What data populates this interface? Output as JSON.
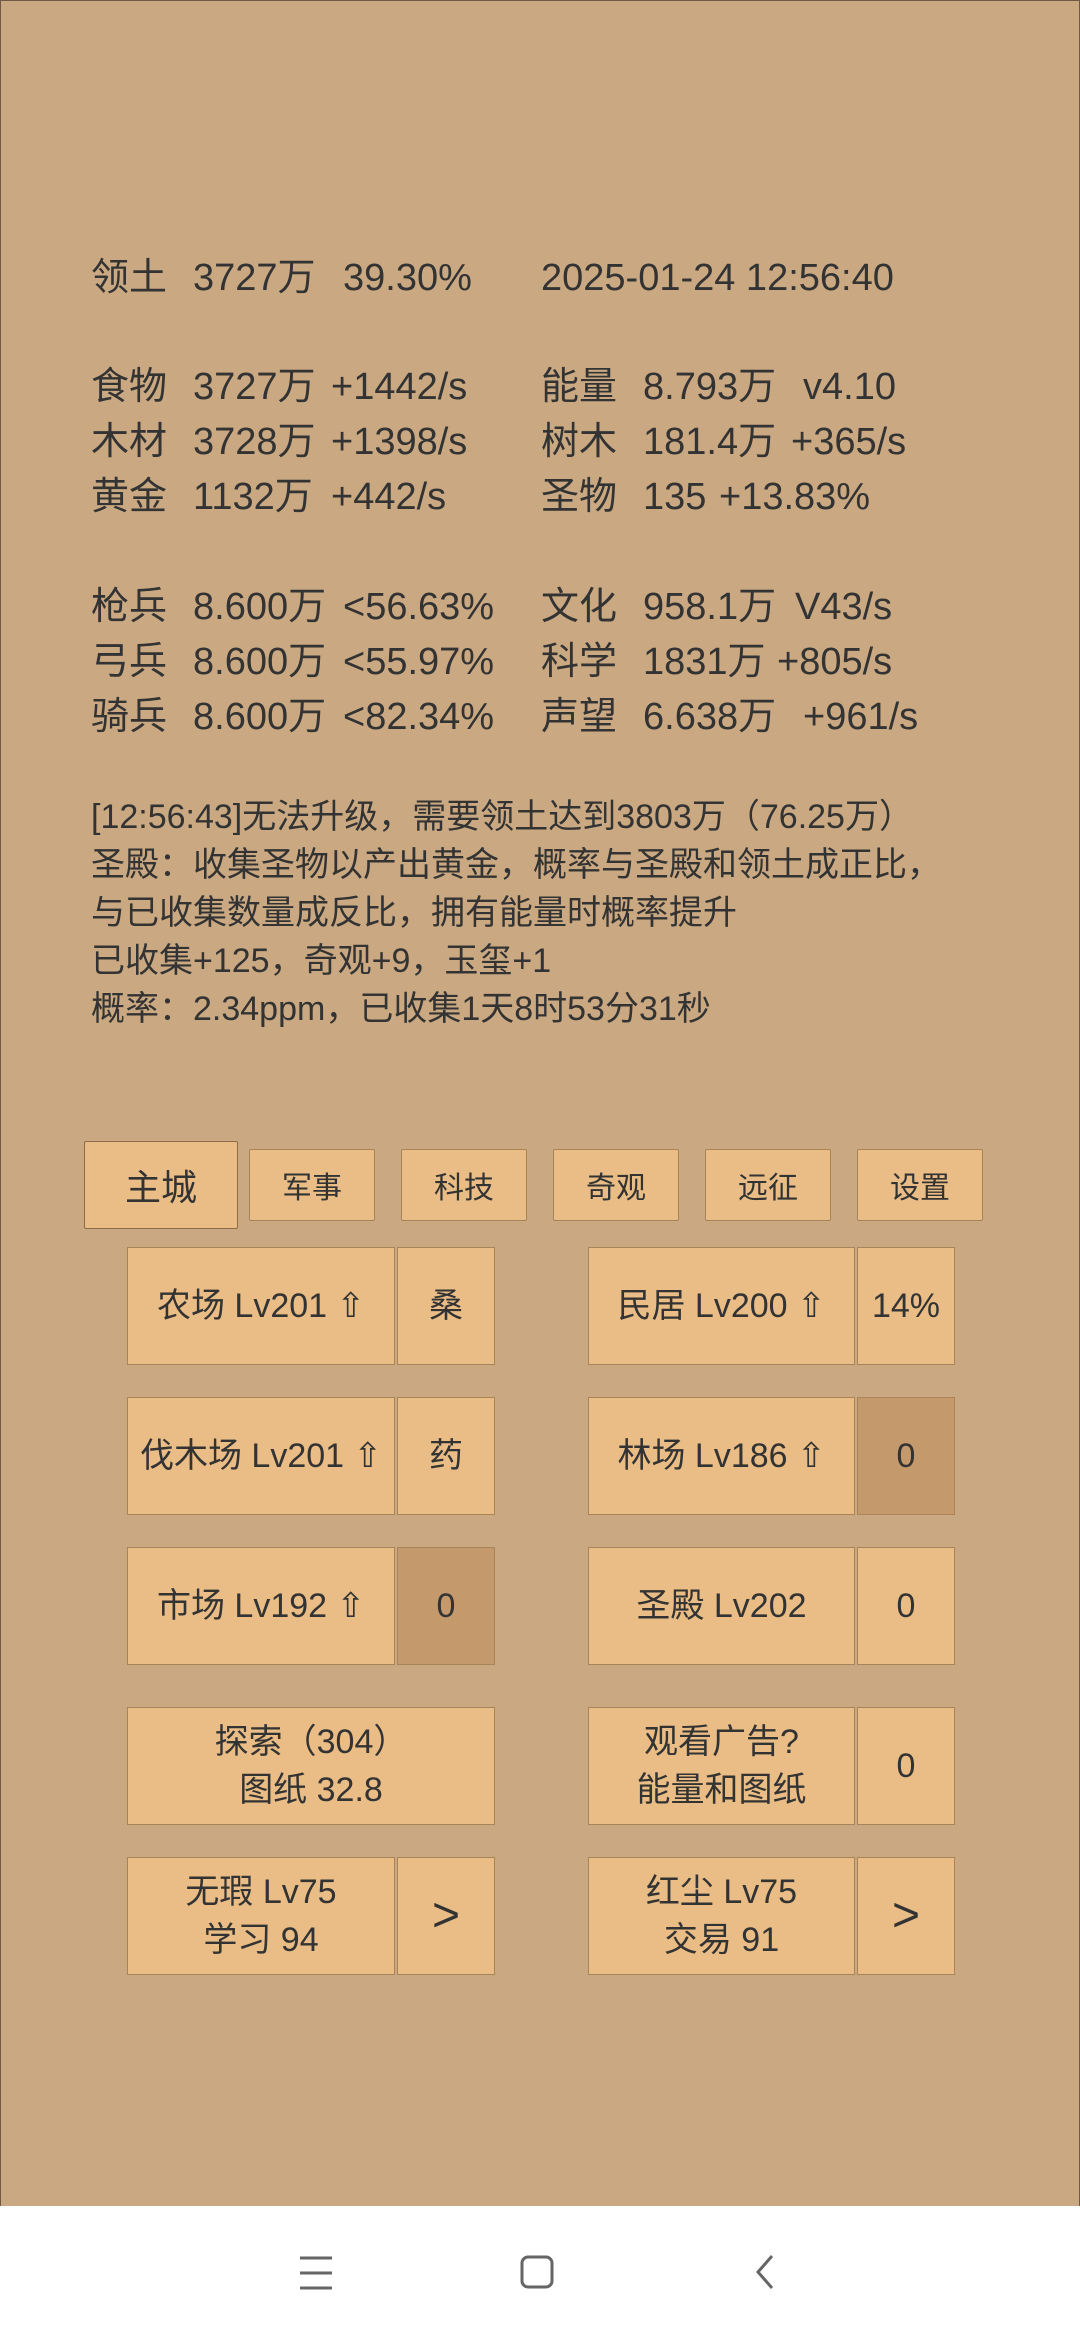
{
  "stats": {
    "territory": {
      "label": "领土",
      "value": "3727万",
      "pct": "39.30%"
    },
    "datetime": "2025-01-24 12:56:40",
    "resources_left": [
      {
        "label": "食物",
        "value": "3727万",
        "rate": "+1442/s"
      },
      {
        "label": "木材",
        "value": "3728万",
        "rate": "+1398/s"
      },
      {
        "label": "黄金",
        "value": "1132万",
        "rate": "+442/s"
      }
    ],
    "resources_right": [
      {
        "label": "能量",
        "value": "8.793万",
        "rate": "v4.10"
      },
      {
        "label": "树木",
        "value": "181.4万",
        "rate": "+365/s"
      },
      {
        "label": "圣物",
        "value": "135",
        "rate": "+13.83%"
      }
    ],
    "troops": [
      {
        "label": "枪兵",
        "value": "8.600万",
        "rate": "<56.63%"
      },
      {
        "label": "弓兵",
        "value": "8.600万",
        "rate": "<55.97%"
      },
      {
        "label": "骑兵",
        "value": "8.600万",
        "rate": "<82.34%"
      }
    ],
    "culture": [
      {
        "label": "文化",
        "value": "958.1万",
        "rate": "V43/s"
      },
      {
        "label": "科学",
        "value": "1831万",
        "rate": "+805/s"
      },
      {
        "label": "声望",
        "value": "6.638万",
        "rate": "+961/s"
      }
    ]
  },
  "messages": [
    "[12:56:43]无法升级，需要领土达到3803万（76.25万）",
    "圣殿：收集圣物以产出黄金，概率与圣殿和领土成正比，",
    "与已收集数量成反比，拥有能量时概率提升",
    "已收集+125，奇观+9，玉玺+1",
    "概率：2.34ppm，已收集1天8时53分31秒"
  ],
  "tabs": [
    "主城",
    "军事",
    "科技",
    "奇观",
    "远征",
    "设置"
  ],
  "buildings": {
    "farm": "农场 Lv201 ⇧",
    "farm_side": "桑",
    "house": "民居 Lv200 ⇧",
    "house_side": "14%",
    "lumber": "伐木场 Lv201 ⇧",
    "lumber_side": "药",
    "forest": "林场 Lv186 ⇧",
    "forest_side": "0",
    "market": "市场 Lv192 ⇧",
    "market_side": "0",
    "temple": "圣殿 Lv202",
    "temple_side": "0"
  },
  "explore": {
    "line1": "探索（304）",
    "line2": "图纸 32.8"
  },
  "ad": {
    "line1": "观看广告?",
    "line2": "能量和图纸",
    "side": "0"
  },
  "hero1": {
    "line1": "无瑕 Lv75",
    "line2": "学习 94",
    "arrow": ">"
  },
  "hero2": {
    "line1": "红尘 Lv75",
    "line2": "交易 91",
    "arrow": ">"
  },
  "nav_icons": [
    "menu-icon",
    "home-square-icon",
    "back-chevron-icon"
  ]
}
